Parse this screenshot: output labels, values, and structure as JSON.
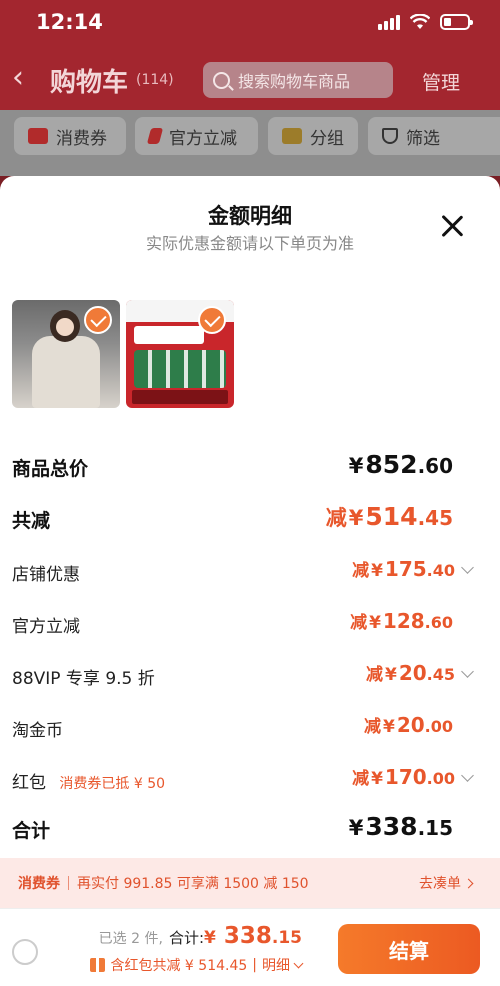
{
  "status_bar": {
    "time": "12:14"
  },
  "header": {
    "title": "购物车",
    "count": "(114)",
    "search_placeholder": "搜索购物车商品",
    "manage": "管理"
  },
  "filters": [
    "消费券",
    "官方立减",
    "分组",
    "筛选"
  ],
  "sheet": {
    "title": "金额明细",
    "subtitle": "实际优惠金额请以下单页为准",
    "products": [
      {
        "name": "product-thumb-jacket",
        "checked": true
      },
      {
        "name": "product-thumb-beer",
        "checked": true
      }
    ],
    "rows": {
      "total_price": {
        "label": "商品总价",
        "yen": "¥",
        "int": "852",
        "dec": ".60"
      },
      "total_discount": {
        "label": "共减",
        "prefix": "减",
        "yen": "¥",
        "int": "514",
        "dec": ".45"
      },
      "shop_discount": {
        "label": "店铺优惠",
        "prefix": "减",
        "yen": "¥",
        "int": "175",
        "dec": ".40"
      },
      "official_discount": {
        "label": "官方立减",
        "prefix": "减",
        "yen": "¥",
        "int": "128",
        "dec": ".60"
      },
      "vip_discount": {
        "label": "88VIP 专享 9.5 折",
        "prefix": "减",
        "yen": "¥",
        "int": "20",
        "dec": ".45"
      },
      "taojinbi": {
        "label": "淘金币",
        "prefix": "减",
        "yen": "¥",
        "int": "20",
        "dec": ".00"
      },
      "red_packet": {
        "label": "红包",
        "note": "消费券已抵 ¥ 50",
        "prefix": "减",
        "yen": "¥",
        "int": "170",
        "dec": ".00"
      },
      "grand_total": {
        "label": "合计",
        "yen": "¥",
        "int": "338",
        "dec": ".15"
      }
    }
  },
  "coupon_bar": {
    "tag": "消费券",
    "text": "再实付 991.85 可享满 1500 减 150",
    "action": "去凑单"
  },
  "bottom_bar": {
    "selected": "已选 2 件,",
    "total_label": "合计:",
    "yen": "¥",
    "int": " 338",
    "dec": ".15",
    "saved": "含红包共减 ¥ 514.45",
    "detail": "明细",
    "checkout": "结算"
  },
  "colors": {
    "accent": "#e8572c",
    "header_red": "#a3262f",
    "checkout": "#ec5a22"
  }
}
